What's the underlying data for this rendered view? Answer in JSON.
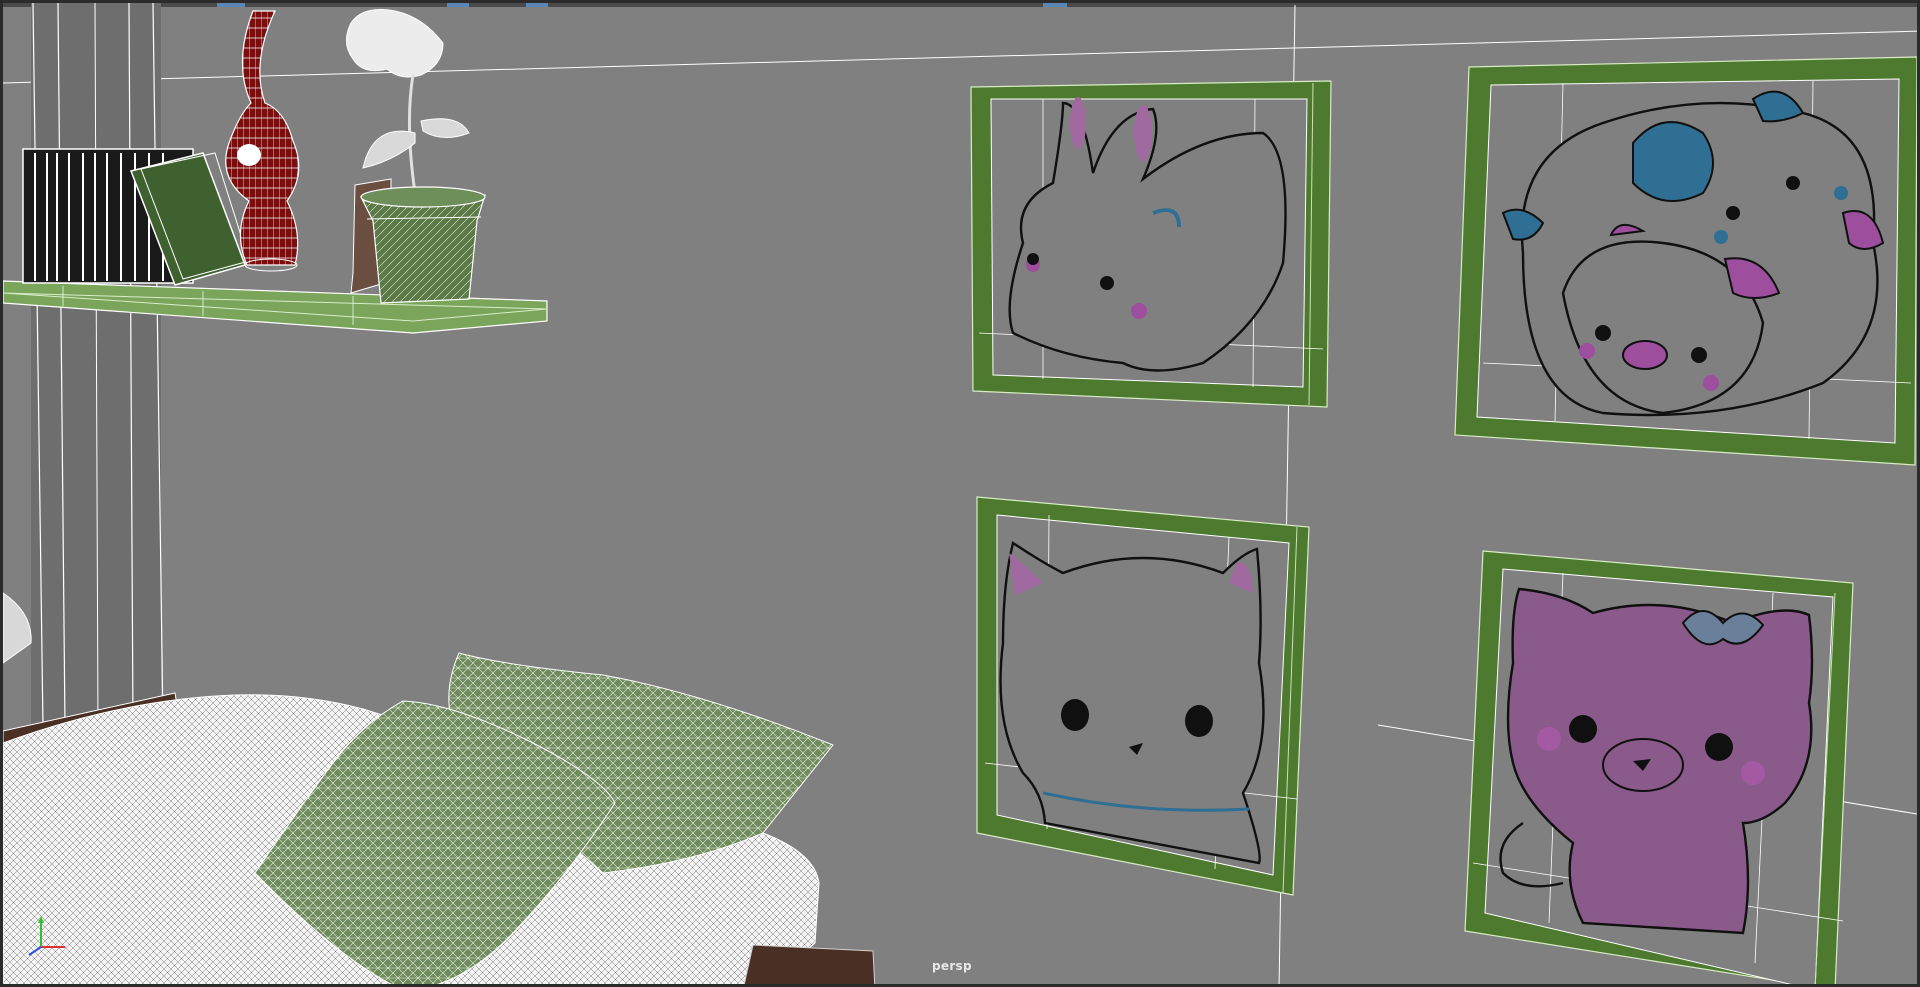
{
  "viewport": {
    "camera_label": "persp"
  },
  "colors": {
    "background": "#808080",
    "wire_white": "#ffffff",
    "frame_green": "#4e7a2f",
    "frame_green_light": "#7fa85a",
    "vase_red": "#7a0d0d",
    "book_green": "#3f6130",
    "pot_green": "#5b7a48",
    "drawing_purple": "#8a4a8a",
    "drawing_blue": "#2f6f93",
    "axis_x": "#e03030",
    "axis_y": "#30c030",
    "axis_z": "#3050e0"
  },
  "icons": {
    "axis_gizmo": "xyz-axis-icon"
  }
}
